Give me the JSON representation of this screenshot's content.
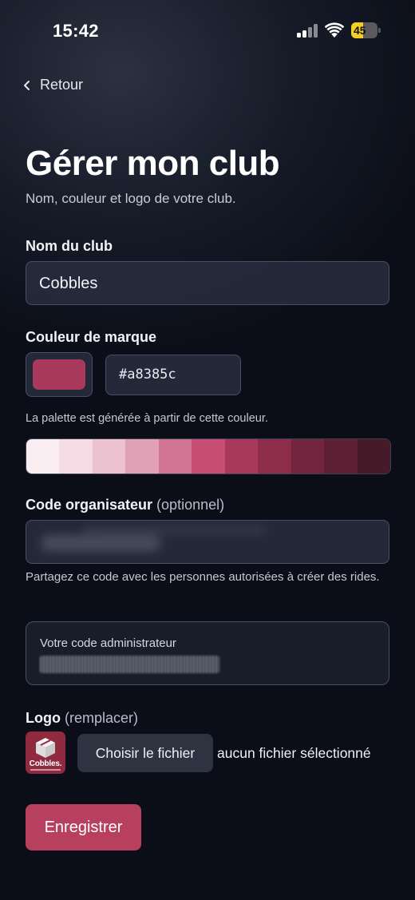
{
  "status_bar": {
    "time": "15:42",
    "battery_level": "45",
    "battery_percent": 45,
    "battery_color": "#f4cf23",
    "icons": [
      "signal-icon",
      "wifi-icon",
      "battery-icon"
    ]
  },
  "nav": {
    "back_label": "Retour",
    "back_icon": "chevron-left-icon"
  },
  "header": {
    "title": "Gérer mon club",
    "subtitle": "Nom, couleur et logo de votre club."
  },
  "form": {
    "club_name": {
      "label": "Nom du club",
      "value": "Cobbles"
    },
    "brand_color": {
      "label": "Couleur de marque",
      "value": "#a8385c",
      "hint": "La palette est générée à partir de cette couleur.",
      "palette": [
        "#fbeef2",
        "#f5dbe3",
        "#edc2d0",
        "#e0a0b5",
        "#d27493",
        "#c84d74",
        "#a8385c",
        "#8c2d4c",
        "#72253f",
        "#5c1f33",
        "#461a28"
      ]
    },
    "organizer_code": {
      "label": "Code organisateur",
      "label_optional": "(optionnel)",
      "hint": "Partagez ce code avec les personnes autorisées à créer des rides."
    },
    "admin_code": {
      "label": "Votre code administrateur"
    },
    "logo": {
      "label": "Logo",
      "label_action": "(remplacer)",
      "thumbnail_text": "Cobbles.",
      "thumbnail_bg": "#8f2a3f",
      "file_button": "Choisir le fichier",
      "file_status": "aucun fichier sélectionné"
    },
    "submit_label": "Enregistrer",
    "submit_color": "#b8405f"
  },
  "theme": {
    "background": "#0c0f19",
    "field_border": "#4a5064"
  }
}
